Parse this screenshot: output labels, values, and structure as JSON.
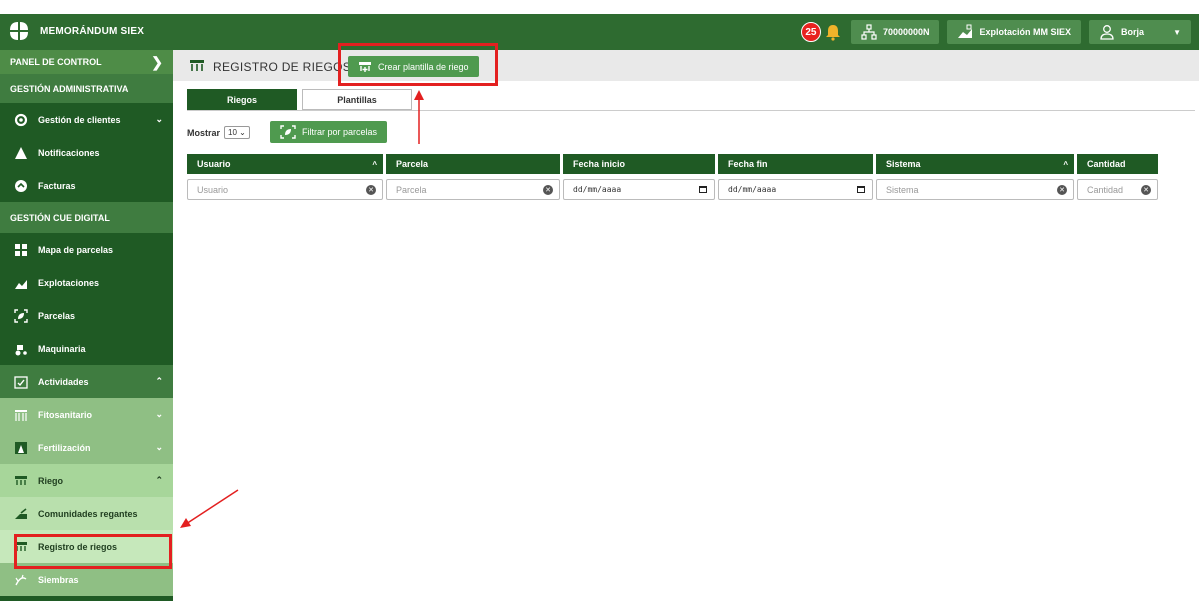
{
  "app": {
    "title": "MEMORÁNDUM SIEX"
  },
  "topbar": {
    "notification_count": "25",
    "cif": "70000000N",
    "explotacion": "Explotación MM SIEX",
    "user": "Borja"
  },
  "sidebar": {
    "panel": "PANEL DE CONTROL",
    "section_admin": "GESTIÓN ADMINISTRATIVA",
    "gestion_clientes": "Gestión de clientes",
    "notificaciones": "Notificaciones",
    "facturas": "Facturas",
    "section_cue": "GESTIÓN CUE DIGITAL",
    "mapa_parcelas": "Mapa de parcelas",
    "explotaciones": "Explotaciones",
    "parcelas": "Parcelas",
    "maquinaria": "Maquinaria",
    "actividades": "Actividades",
    "fitosanitario": "Fitosanitario",
    "fertilizacion": "Fertilización",
    "riego": "Riego",
    "comunidades": "Comunidades regantes",
    "registro": "Registro de riegos",
    "siembras": "Siembras"
  },
  "main": {
    "title": "REGISTRO DE RIEGOS",
    "create_button": "Crear plantilla de riego",
    "tabs": [
      "Riegos",
      "Plantillas"
    ],
    "mostrar_label": "Mostrar",
    "mostrar_value": "10",
    "filter_button": "Filtrar por parcelas",
    "columns": [
      "Usuario",
      "Parcela",
      "Fecha inicio",
      "Fecha fin",
      "Sistema",
      "Cantidad"
    ],
    "filters": {
      "usuario": "Usuario",
      "parcela": "Parcela",
      "fecha_inicio": "dd/mm/aaaa",
      "fecha_fin": "dd/mm/aaaa",
      "sistema": "Sistema",
      "cantidad": "Cantidad"
    }
  },
  "colors": {
    "primary": "#1f5a24",
    "accent": "#4f9a4f",
    "highlight": "#e32020"
  }
}
